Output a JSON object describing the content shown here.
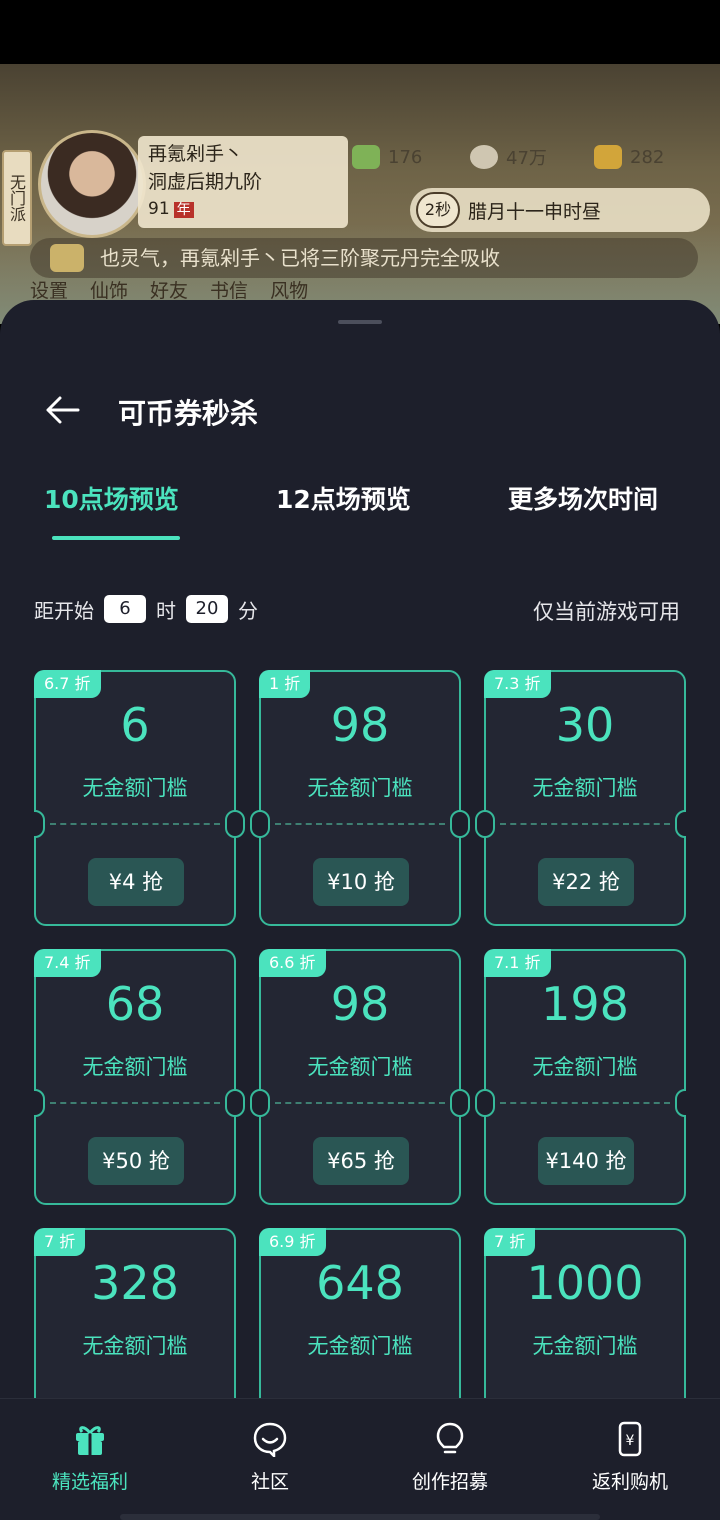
{
  "game": {
    "sect": "无门派",
    "player_name": "再氪剁手丶",
    "realm": "洞虚后期九阶",
    "age": "91",
    "age_unit": "年",
    "resources": [
      "176",
      "47万",
      "282"
    ],
    "timer_badge": "2秒",
    "time_text": "腊月十一申时昼",
    "notice": "也灵气，再氪剁手丶已将三阶聚元丹完全吸收",
    "menu": [
      "设置",
      "仙饰",
      "好友",
      "书信",
      "风物"
    ]
  },
  "sheet": {
    "title": "可币券秒杀",
    "tabs": [
      {
        "label": "10点场预览",
        "active": true
      },
      {
        "label": "12点场预览",
        "active": false
      },
      {
        "label": "更多场次时间",
        "active": false
      }
    ],
    "countdown": {
      "prefix": "距开始",
      "hours": "6",
      "hours_unit": "时",
      "minutes": "20",
      "minutes_unit": "分"
    },
    "scope_note": "仅当前游戏可用",
    "coupons": [
      {
        "discount": "6.7 折",
        "amount": "6",
        "condition": "无金额门槛",
        "price": "¥4 抢"
      },
      {
        "discount": "1 折",
        "amount": "98",
        "condition": "无金额门槛",
        "price": "¥10 抢"
      },
      {
        "discount": "7.3 折",
        "amount": "30",
        "condition": "无金额门槛",
        "price": "¥22 抢"
      },
      {
        "discount": "7.4 折",
        "amount": "68",
        "condition": "无金额门槛",
        "price": "¥50 抢"
      },
      {
        "discount": "6.6 折",
        "amount": "98",
        "condition": "无金额门槛",
        "price": "¥65 抢"
      },
      {
        "discount": "7.1 折",
        "amount": "198",
        "condition": "无金额门槛",
        "price": "¥140 抢"
      },
      {
        "discount": "7 折",
        "amount": "328",
        "condition": "无金额门槛",
        "price": ""
      },
      {
        "discount": "6.9 折",
        "amount": "648",
        "condition": "无金额门槛",
        "price": ""
      },
      {
        "discount": "7 折",
        "amount": "1000",
        "condition": "无金额门槛",
        "price": ""
      }
    ]
  },
  "nav": [
    {
      "label": "精选福利",
      "icon": "gift-icon",
      "active": true
    },
    {
      "label": "社区",
      "icon": "community-icon",
      "active": false
    },
    {
      "label": "创作招募",
      "icon": "lightbulb-icon",
      "active": false
    },
    {
      "label": "返利购机",
      "icon": "phone-yen-icon",
      "active": false
    }
  ],
  "colors": {
    "accent": "#4be3be",
    "sheet_bg": "#1d1f2b",
    "card_border": "#36b99a",
    "buy_button": "#2a5654"
  }
}
